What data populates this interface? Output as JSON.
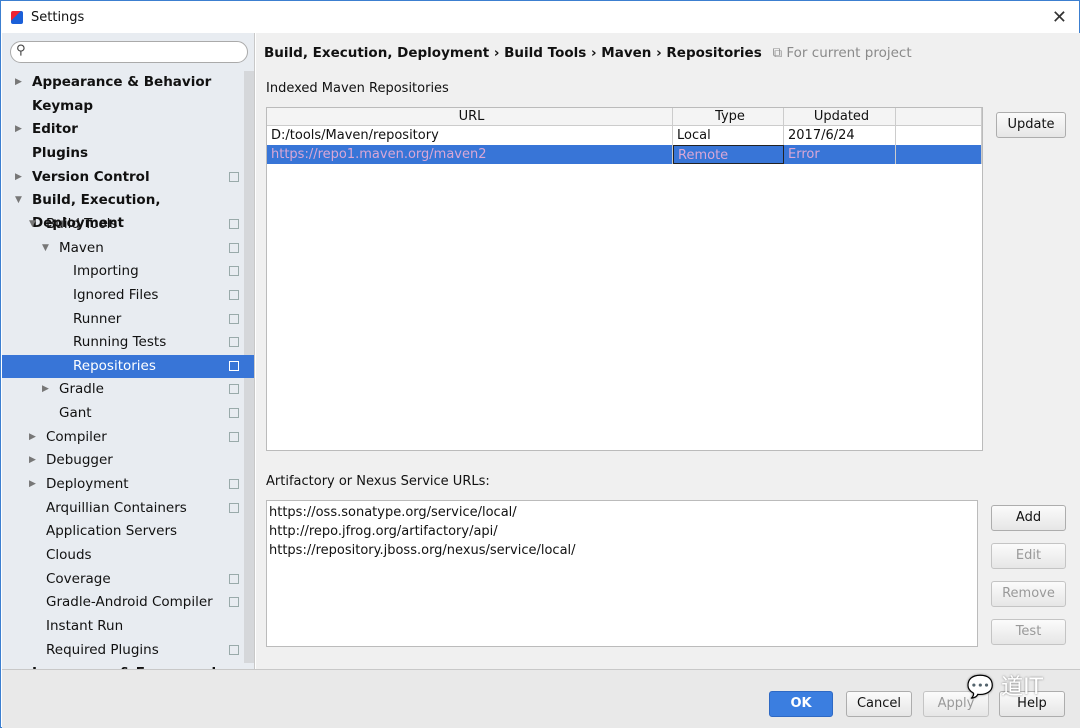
{
  "window": {
    "title": "Settings"
  },
  "search": {
    "placeholder": ""
  },
  "sidebar": {
    "items": [
      {
        "label": "Appearance & Behavior",
        "bold": true,
        "arrow": "right",
        "level": 0
      },
      {
        "label": "Keymap",
        "bold": true,
        "level": 0
      },
      {
        "label": "Editor",
        "bold": true,
        "arrow": "right",
        "level": 0
      },
      {
        "label": "Plugins",
        "bold": true,
        "level": 0
      },
      {
        "label": "Version Control",
        "bold": true,
        "arrow": "right",
        "level": 0,
        "copy": true
      },
      {
        "label": "Build, Execution, Deployment",
        "bold": true,
        "arrow": "down",
        "level": 0
      },
      {
        "label": "Build Tools",
        "arrow": "down",
        "level": 1,
        "copy": true
      },
      {
        "label": "Maven",
        "arrow": "down",
        "level": 2,
        "copy": true
      },
      {
        "label": "Importing",
        "level": 3,
        "copy": true
      },
      {
        "label": "Ignored Files",
        "level": 3,
        "copy": true
      },
      {
        "label": "Runner",
        "level": 3,
        "copy": true
      },
      {
        "label": "Running Tests",
        "level": 3,
        "copy": true
      },
      {
        "label": "Repositories",
        "level": 3,
        "copy": true,
        "selected": true
      },
      {
        "label": "Gradle",
        "arrow": "right",
        "level": 2,
        "copy": true
      },
      {
        "label": "Gant",
        "level": 2,
        "copy": true
      },
      {
        "label": "Compiler",
        "arrow": "right",
        "level": 1,
        "copy": true
      },
      {
        "label": "Debugger",
        "arrow": "right",
        "level": 1
      },
      {
        "label": "Deployment",
        "arrow": "right",
        "level": 1,
        "copy": true
      },
      {
        "label": "Arquillian Containers",
        "level": 1,
        "copy": true
      },
      {
        "label": "Application Servers",
        "level": 1
      },
      {
        "label": "Clouds",
        "level": 1
      },
      {
        "label": "Coverage",
        "level": 1,
        "copy": true
      },
      {
        "label": "Gradle-Android Compiler",
        "level": 1,
        "copy": true
      },
      {
        "label": "Instant Run",
        "level": 1
      },
      {
        "label": "Required Plugins",
        "level": 1,
        "copy": true
      },
      {
        "label": "Languages & Frameworks",
        "bold": true,
        "arrow": "right",
        "level": 0
      }
    ]
  },
  "breadcrumb": {
    "parts": [
      "Build, Execution, Deployment",
      "Build Tools",
      "Maven",
      "Repositories"
    ],
    "separator": "›",
    "hint": "For current project"
  },
  "indexed": {
    "title": "Indexed Maven Repositories",
    "columns": [
      "URL",
      "Type",
      "Updated"
    ],
    "rows": [
      {
        "url": "D:/tools/Maven/repository",
        "type": "Local",
        "updated": "2017/6/24"
      },
      {
        "url": "https://repo1.maven.org/maven2",
        "type": "Remote",
        "updated": "Error",
        "selected": true
      }
    ],
    "update_button": "Update"
  },
  "services": {
    "title": "Artifactory or Nexus Service URLs:",
    "urls": [
      "https://oss.sonatype.org/service/local/",
      "http://repo.jfrog.org/artifactory/api/",
      "https://repository.jboss.org/nexus/service/local/"
    ],
    "add": "Add",
    "edit": "Edit",
    "remove": "Remove",
    "test": "Test"
  },
  "footer": {
    "ok": "OK",
    "cancel": "Cancel",
    "apply": "Apply",
    "help": "Help"
  },
  "watermark": "道IT",
  "colors": {
    "selection": "#3875d7",
    "ok": "#3b7ee0"
  }
}
